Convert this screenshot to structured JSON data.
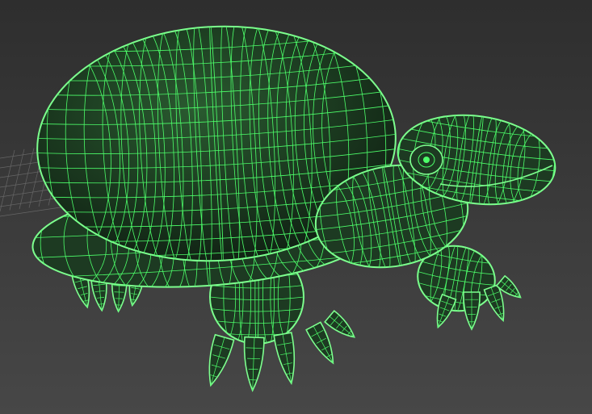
{
  "viewport": {
    "background_top": "#2e2e2e",
    "background_bottom": "#474747",
    "grid_color": "#8a8a8a",
    "wire_color": "#4dff6a",
    "wire_bright": "#7dff8e",
    "shell_fill": "#1d3a22",
    "shell_shadow": "#0f1f12",
    "model": "turtle-wireframe-mesh",
    "icon": "turtle-icon"
  }
}
